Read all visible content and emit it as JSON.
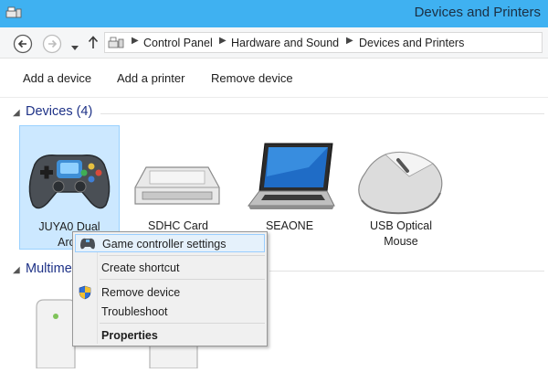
{
  "window": {
    "title": "Devices and Printers"
  },
  "breadcrumb": [
    "Control Panel",
    "Hardware and Sound",
    "Devices and Printers"
  ],
  "toolbar": {
    "add_device": "Add a device",
    "add_printer": "Add a printer",
    "remove_device": "Remove device"
  },
  "groups": {
    "devices": "Devices (4)",
    "multimedia": "Multimedia Devices"
  },
  "devices": [
    {
      "line1": "JUYA0 Dual",
      "line2": "Arca",
      "icon": "gamepad-icon"
    },
    {
      "line1": "SDHC Card",
      "line2": "",
      "icon": "card-reader-icon"
    },
    {
      "line1": "SEAONE",
      "line2": "",
      "icon": "laptop-icon"
    },
    {
      "line1": "USB Optical",
      "line2": "Mouse",
      "icon": "mouse-icon"
    }
  ],
  "context_menu": {
    "game_controller_settings": "Game controller settings",
    "create_shortcut": "Create shortcut",
    "remove_device": "Remove device",
    "troubleshoot": "Troubleshoot",
    "properties": "Properties"
  },
  "colors": {
    "titlebar": "#3fb1f1",
    "group_header": "#1e3287",
    "selection": "#cce8ff",
    "menu_highlight": "#e5f1fb"
  }
}
